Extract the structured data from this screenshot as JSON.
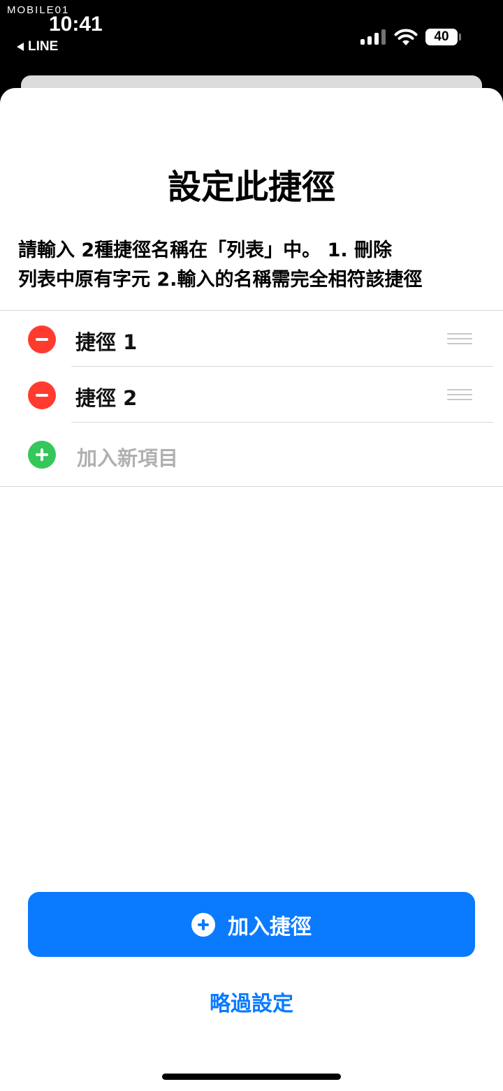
{
  "status_bar": {
    "watermark": "MOBILE01",
    "time": "10:41",
    "back_app": "LINE",
    "battery": "40",
    "icons": [
      "cellular-signal-icon",
      "wifi-icon",
      "battery-icon"
    ]
  },
  "sheet": {
    "title": "設定此捷徑",
    "description_line1": "請輸入 2種捷徑名稱在「列表」中。  1. 刪除",
    "description_line2": "列表中原有字元 2.輸入的名稱需完全相符該捷徑",
    "list": {
      "items": [
        {
          "label": "捷徑 1"
        },
        {
          "label": "捷徑 2"
        }
      ],
      "add_placeholder": "加入新項目"
    },
    "primary_button_label": "加入捷徑",
    "skip_label": "略過設定"
  },
  "colors": {
    "accent": "#0a7aff",
    "remove": "#ff3b30",
    "add": "#34c759",
    "placeholder": "#b0b0b0"
  }
}
